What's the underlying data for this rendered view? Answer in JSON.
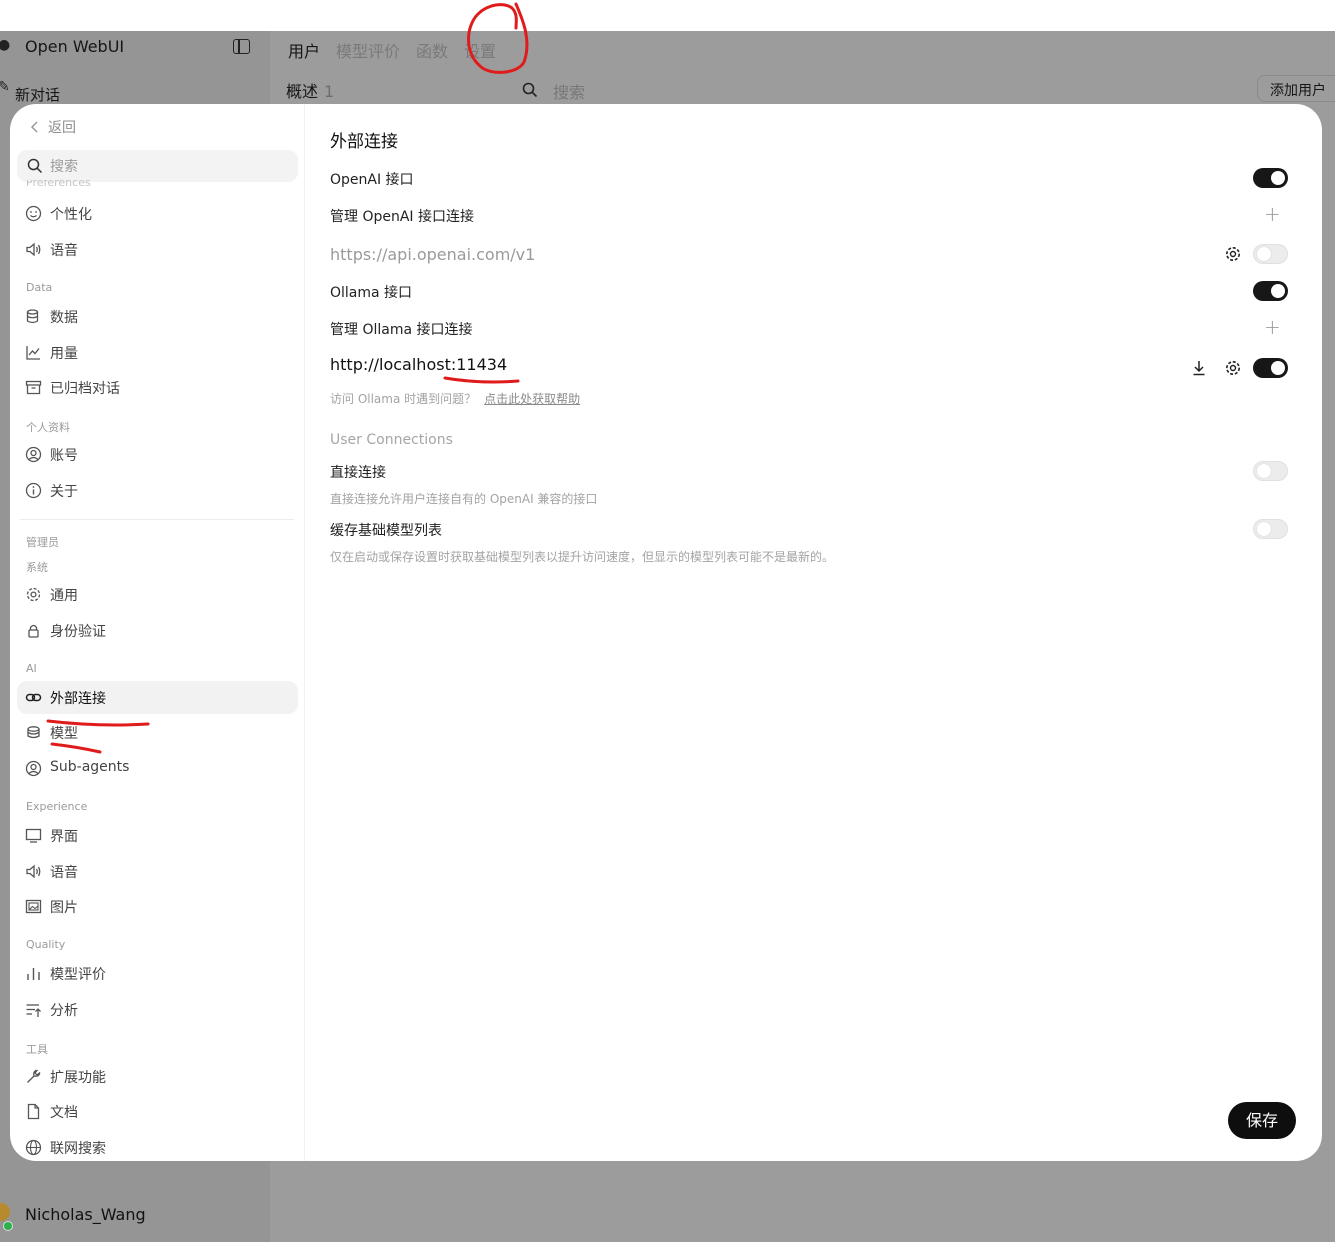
{
  "app": {
    "title": "Open WebUI",
    "new_chat": "新对话",
    "user_name": "Nicholas_Wang",
    "tabs": [
      "用户",
      "模型评价",
      "函数",
      "设置"
    ],
    "overview_label": "概述",
    "user_count": "1",
    "search_placeholder": "搜索",
    "add_user_button": "添加用户"
  },
  "modal": {
    "back_label": "返回",
    "search_placeholder": "搜索",
    "cut_group_label": "Preferences",
    "groups": {
      "data": "Data",
      "profile": "个人资料",
      "admin": "管理员",
      "system": "系统",
      "ai": "AI",
      "experience": "Experience",
      "quality": "Quality",
      "tools": "工具"
    },
    "nav": {
      "personalize": "个性化",
      "voice": "语音",
      "data": "数据",
      "usage": "用量",
      "archived": "已归档对话",
      "account": "账号",
      "about": "关于",
      "general": "通用",
      "auth": "身份验证",
      "connections": "外部连接",
      "models": "模型",
      "subagents": "Sub-agents",
      "interface": "界面",
      "voice2": "语音",
      "images": "图片",
      "evaluations": "模型评价",
      "analytics": "分析",
      "extensions": "扩展功能",
      "documents": "文档",
      "web_search": "联网搜索"
    },
    "content": {
      "title": "外部连接",
      "openai_api": "OpenAI 接口",
      "manage_openai": "管理 OpenAI 接口连接",
      "openai_url": "https://api.openai.com/v1",
      "ollama_api": "Ollama 接口",
      "manage_ollama": "管理 Ollama 接口连接",
      "ollama_url": "http://localhost:11434",
      "ollama_hint": "访问 Ollama 时遇到问题？",
      "ollama_help_link": "点击此处获取帮助",
      "user_connections": "User Connections",
      "direct_connections": "直接连接",
      "direct_hint": "直接连接允许用户连接自有的 OpenAI 兼容的接口",
      "cache_models": "缓存基础模型列表",
      "cache_hint": "仅在启动或保存设置时获取基础模型列表以提升访问速度，但显示的模型列表可能不是最新的。",
      "toggles": {
        "openai_api": true,
        "openai_connection": false,
        "ollama_api": true,
        "ollama_connection": true,
        "direct_connections": false,
        "cache_models": false
      },
      "save_button": "保存"
    }
  },
  "colors": {
    "annotation": "#e01b1b",
    "toggle_on": "#171717",
    "overlay": "#9c9c9c"
  }
}
